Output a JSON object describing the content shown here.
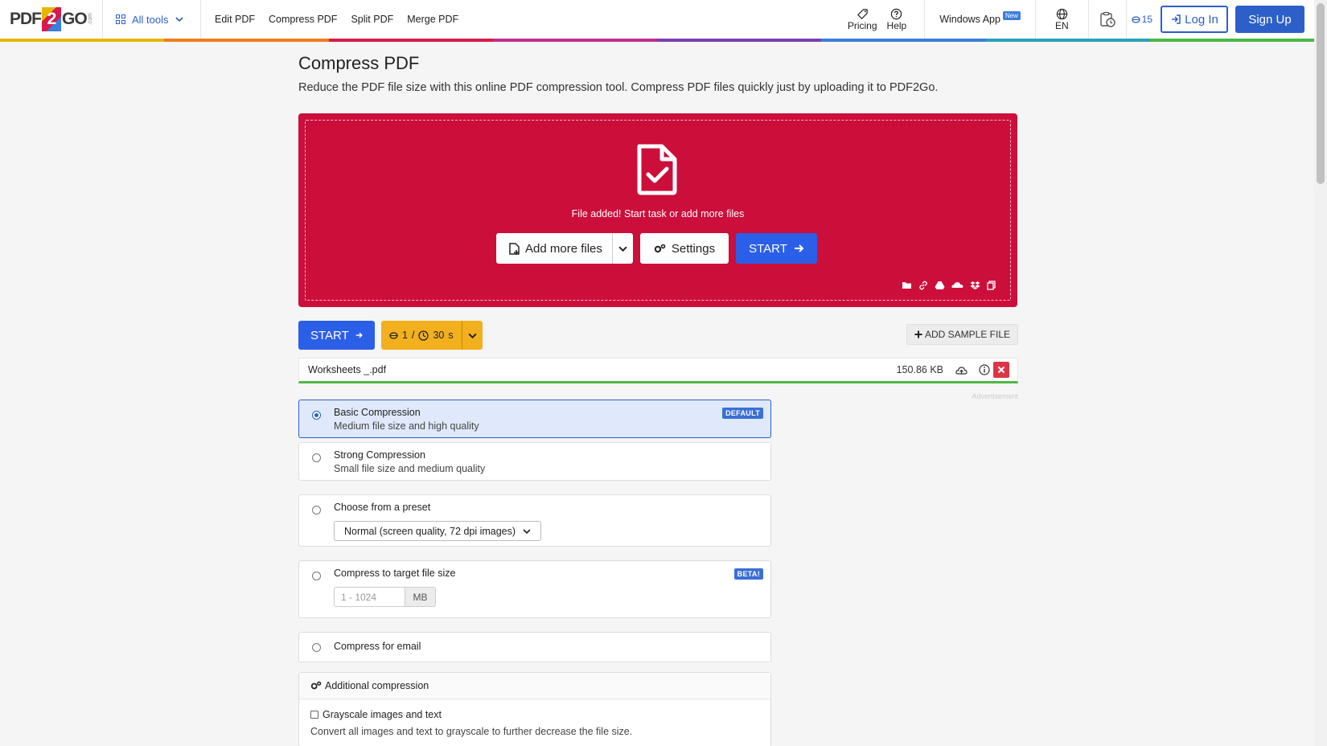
{
  "header": {
    "logo_pdf": "PDF",
    "logo_two": "2",
    "logo_go": "GO",
    "logo_com": ".com",
    "all_tools": "All tools",
    "nav": [
      "Edit PDF",
      "Compress PDF",
      "Split PDF",
      "Merge PDF"
    ],
    "pricing": "Pricing",
    "help": "Help",
    "windows_app": "Windows App",
    "new_badge": "New",
    "lang": "EN",
    "credits": "15",
    "login": "Log In",
    "signup": "Sign Up"
  },
  "rainbow_colors": [
    "#e8b500",
    "#f07d1b",
    "#d41b4b",
    "#c22d8f",
    "#7a3fb0",
    "#3b7ddd",
    "#2aa0b9",
    "#4cb944"
  ],
  "page": {
    "title": "Compress PDF",
    "subtitle": "Reduce the PDF file size with this online PDF compression tool. Compress PDF files quickly just by uploading it to PDF2Go."
  },
  "dropzone": {
    "message": "File added! Start task or add more files",
    "add_more": "Add more files",
    "settings": "Settings",
    "start": "START",
    "color": "#cc0e3b"
  },
  "toolbar": {
    "start": "START",
    "credit_count": "1",
    "credit_sep": "/",
    "time": "30",
    "time_unit": "s",
    "add_sample": "ADD SAMPLE FILE"
  },
  "file": {
    "name": "Worksheets _.pdf",
    "size": "150.86 KB"
  },
  "advertisement": "Advertisement",
  "options": {
    "basic": {
      "title": "Basic Compression",
      "desc": "Medium file size and high quality",
      "tag": "DEFAULT"
    },
    "strong": {
      "title": "Strong Compression",
      "desc": "Small file size and medium quality"
    },
    "preset": {
      "title": "Choose from a preset",
      "selected": "Normal (screen quality, 72 dpi images)"
    },
    "target": {
      "title": "Compress to target file size",
      "tag": "BETA!",
      "placeholder": "1 - 1024",
      "unit": "MB"
    },
    "email": {
      "title": "Compress for email"
    }
  },
  "additional": {
    "title": "Additional compression",
    "grayscale_label": "Grayscale images and text",
    "grayscale_desc": "Convert all images and text to grayscale to further decrease the file size."
  }
}
